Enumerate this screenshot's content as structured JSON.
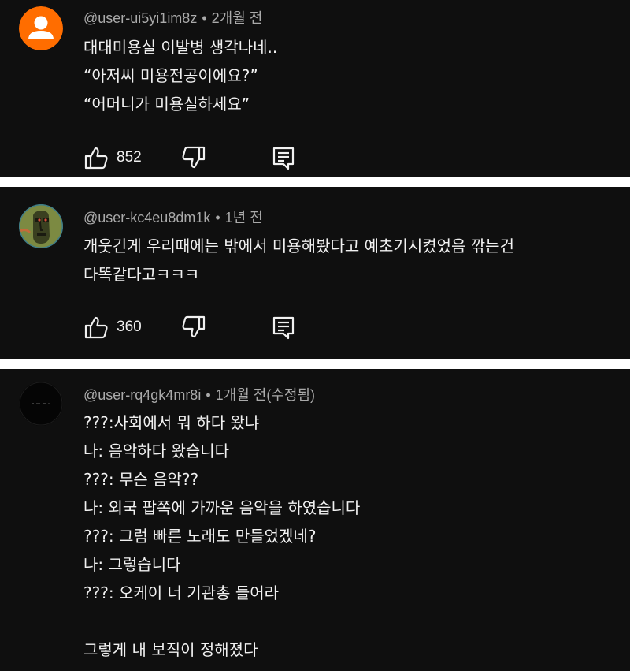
{
  "comments": [
    {
      "username": "@user-ui5yi1im8z",
      "separator": "•",
      "time": "2개월 전",
      "avatar_icon": "person-silhouette-icon",
      "avatar_bg": "#ff6d00",
      "lines": [
        "대대미용실 이발병 생각나네..",
        "“아저씨 미용전공이에요?”",
        "“어머니가 미용실하세요”"
      ],
      "likes": "852"
    },
    {
      "username": "@user-kc4eu8dm1k",
      "separator": "•",
      "time": "1년 전",
      "avatar_icon": "moai-statue-icon",
      "avatar_bg": "#6a7a3a",
      "lines": [
        "개웃긴게 우리때에는 밖에서 미용해봤다고 예초기시켰었음 깎는건",
        "다똑같다고ㅋㅋㅋ"
      ],
      "likes": "360"
    },
    {
      "username": "@user-rq4gk4mr8i",
      "separator": "•",
      "time": "1개월 전(수정됨)",
      "avatar_icon": "dark-avatar-icon",
      "avatar_bg": "#050505",
      "lines": [
        "???:사회에서 뭐 하다 왔냐",
        "나: 음악하다 왔습니다",
        "???: 무슨 음악??",
        "나: 외국 팝쪽에 가까운 음악을 하였습니다",
        "???: 그럼 빠른 노래도 만들었겠네?",
        "나: 그렇습니다",
        "???: 오케이 너 기관총 들어라",
        "",
        "그렇게 내 보직이 정해졌다"
      ]
    }
  ],
  "icons": {
    "like": "thumbs-up-icon",
    "dislike": "thumbs-down-icon",
    "reply": "reply-comment-icon"
  },
  "colors": {
    "background": "#0f0f0f",
    "text": "#f1f1f1",
    "meta": "#aaaaaa",
    "separator": "#ffffff"
  }
}
